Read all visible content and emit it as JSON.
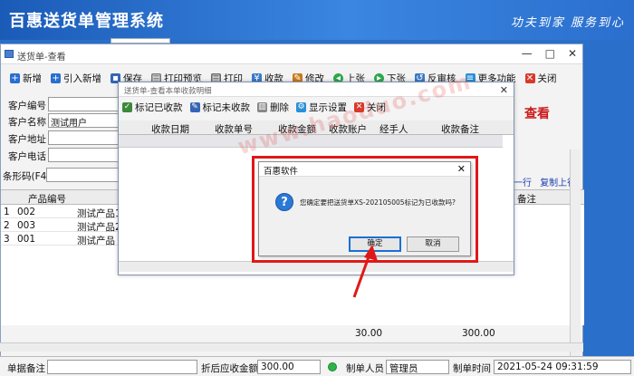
{
  "app": {
    "title": "百惠送货单管理系统",
    "slogan": "功夫到家 服务到心"
  },
  "main_window": {
    "title": "送货单-查看",
    "controls": {
      "minimize": "—",
      "maximize": "□",
      "close": "✕"
    },
    "toolbar": [
      {
        "label": "新增",
        "icon": "plus-icon",
        "color": "#2a6fd0"
      },
      {
        "label": "引入新增",
        "icon": "plus-icon",
        "color": "#2a6fd0"
      },
      {
        "label": "保存",
        "icon": "save-icon",
        "color": "#3565b5"
      },
      {
        "label": "打印预览",
        "icon": "print-preview-icon",
        "color": "#777777"
      },
      {
        "label": "打印",
        "icon": "print-icon",
        "color": "#666666"
      },
      {
        "label": "收款",
        "icon": "money-icon",
        "color": "#3a78c8"
      },
      {
        "label": "修改",
        "icon": "edit-icon",
        "color": "#c87a1a"
      },
      {
        "label": "上张",
        "icon": "prev-icon",
        "color": "#2ca84a"
      },
      {
        "label": "下张",
        "icon": "next-icon",
        "color": "#2ca84a"
      },
      {
        "label": "反审核",
        "icon": "unaudit-icon",
        "color": "#3a78c8"
      },
      {
        "label": "更多功能",
        "icon": "more-icon",
        "color": "#2b8fd8"
      },
      {
        "label": "关闭",
        "icon": "close-icon",
        "color": "#d83a2a"
      }
    ],
    "form": {
      "customer_code_label": "客户编号",
      "customer_name_label": "客户名称",
      "customer_name_value": "测试用户",
      "customer_address_label": "客户地址",
      "customer_phone_label": "客户电话",
      "barcode_label": "条形码(F4)"
    },
    "view_mark": "查看",
    "right_links": {
      "line_op": "一行",
      "copy_up": "复制上行"
    },
    "grid": {
      "col_product_code": "产品编号",
      "col_remark": "备注",
      "rows": [
        {
          "no": "1",
          "code": "002",
          "name": "测试产品1"
        },
        {
          "no": "2",
          "code": "003",
          "name": "测试产品2"
        },
        {
          "no": "3",
          "code": "001",
          "name": "测试产品"
        }
      ]
    },
    "totals": {
      "qty_total": "30.00",
      "amount_total": "300.00"
    }
  },
  "footer": {
    "remark_label": "单据备注",
    "discount_label": "折后应收金额",
    "discount_value": "300.00",
    "maker_label": "制单人员",
    "maker_value": "管理员",
    "time_label": "制单时间",
    "time_value": "2021-05-24 09:31:59"
  },
  "receipt_window": {
    "title": "送货单-查看本单收款明细",
    "close": "✕",
    "toolbar": [
      {
        "label": "标记已收款",
        "icon": "mark-received-icon",
        "color": "#3a8a3a"
      },
      {
        "label": "标记未收款",
        "icon": "mark-unreceived-icon",
        "color": "#3565b5"
      },
      {
        "label": "删除",
        "icon": "delete-icon",
        "color": "#888888"
      },
      {
        "label": "显示设置",
        "icon": "settings-icon",
        "color": "#2b8fd8"
      },
      {
        "label": "关闭",
        "icon": "close-icon",
        "color": "#d83a2a"
      }
    ],
    "columns": [
      "收款日期",
      "收款单号",
      "收款金额",
      "收款账户",
      "经手人",
      "收款备注"
    ]
  },
  "watermark": "www.haoduo.com",
  "dialog": {
    "title": "百惠软件",
    "close": "✕",
    "message": "您确定要把送货单XS-202105005标记为已收款吗?",
    "ok_label": "确定",
    "cancel_label": "取消"
  },
  "colors": {
    "highlight": "#e01818",
    "accent": "#2a6fc9"
  }
}
